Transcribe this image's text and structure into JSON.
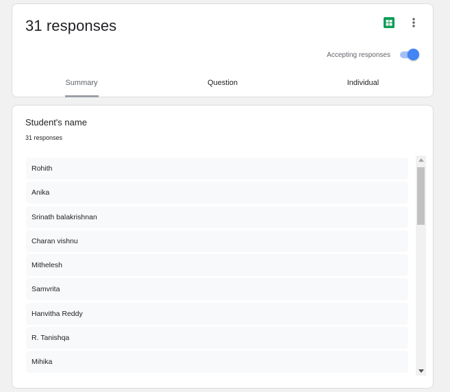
{
  "header": {
    "title": "31 responses",
    "accepting_label": "Accepting responses",
    "accepting_on": true,
    "tabs": [
      {
        "label": "Summary",
        "active": true
      },
      {
        "label": "Question",
        "active": false
      },
      {
        "label": "Individual",
        "active": false
      }
    ],
    "icons": [
      "google-sheets-icon",
      "more-vert-icon"
    ]
  },
  "question": {
    "title": "Student's name",
    "count": "31 responses",
    "responses": [
      "Rohith",
      "Anika",
      "Srinath balakrishnan",
      "Charan vishnu",
      "Mithelesh",
      "Samvrita",
      "Hanvitha Reddy",
      "R. Tanishqa",
      "Mihika"
    ]
  },
  "colors": {
    "accent": "#4285f4",
    "sheets_green": "#0f9d58",
    "background": "#f1f1f1"
  }
}
